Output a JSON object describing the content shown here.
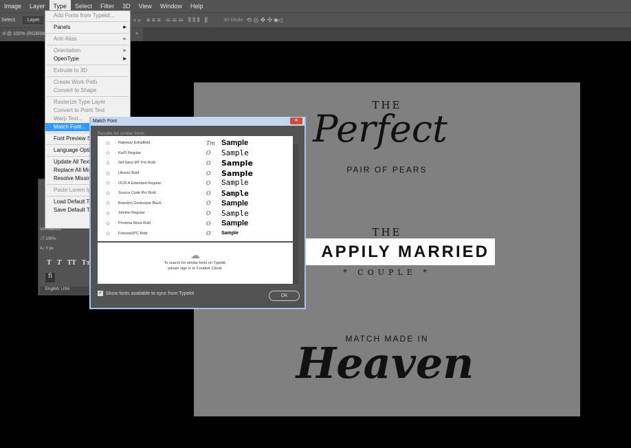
{
  "menubar": [
    "Image",
    "Layer",
    "Type",
    "Select",
    "Filter",
    "3D",
    "View",
    "Window",
    "Help"
  ],
  "options": {
    "select_label": "Select:",
    "select_value": "Layer",
    "mode_label": "3D Mode:"
  },
  "tab": {
    "title": "d @ 100% (RGB/8#)",
    "close": "×"
  },
  "type_menu": [
    {
      "label": "Add Fonts from Typekit...",
      "disabled": true
    },
    {
      "sep": true
    },
    {
      "label": "Panels",
      "sub": true
    },
    {
      "sep": true
    },
    {
      "label": "Anti-Alias",
      "disabled": true,
      "sub": true
    },
    {
      "sep": true
    },
    {
      "label": "Orientation",
      "disabled": true,
      "sub": true
    },
    {
      "label": "OpenType",
      "sub": true
    },
    {
      "sep": true
    },
    {
      "label": "Extrude to 3D",
      "disabled": true
    },
    {
      "sep": true
    },
    {
      "label": "Create Work Path",
      "disabled": true
    },
    {
      "label": "Convert to Shape",
      "disabled": true
    },
    {
      "sep": true
    },
    {
      "label": "Rasterize Type Layer",
      "disabled": true
    },
    {
      "label": "Convert to Point Text",
      "disabled": true
    },
    {
      "label": "Warp Text...",
      "disabled": true
    },
    {
      "label": "Match Font...",
      "highlight": true
    },
    {
      "sep": true
    },
    {
      "label": "Font Preview Size",
      "sub": true
    },
    {
      "sep": true
    },
    {
      "label": "Language Options",
      "sub": true
    },
    {
      "sep": true
    },
    {
      "label": "Update All Text Layers"
    },
    {
      "label": "Replace All Missing Fonts"
    },
    {
      "label": "Resolve Missing Fonts"
    },
    {
      "sep": true
    },
    {
      "label": "Paste Lorem Ipsum",
      "disabled": true
    },
    {
      "sep": true
    },
    {
      "label": "Load Default Type Styles"
    },
    {
      "label": "Save Default Type Styles"
    }
  ],
  "char_panel": {
    "kerning": "Metrics",
    "scale": "100%",
    "baseline": "0 px",
    "language": "English: USA",
    "styles": [
      "T",
      "T",
      "TT",
      "Tт"
    ]
  },
  "dialog": {
    "title": "Match Font",
    "close": "✕",
    "subtitle": "Results for similar fonts:",
    "fonts": [
      {
        "name": "Raleway ExtraBold",
        "icon": "Tт",
        "sample": "Sample"
      },
      {
        "name": "KaiTi Regular",
        "icon": "O",
        "sample": "Sample"
      },
      {
        "name": "Gill Sans MT Pro Bold",
        "icon": "O",
        "sample": "Sample"
      },
      {
        "name": "Ubuntu Bold",
        "icon": "O",
        "sample": "Sample"
      },
      {
        "name": "OCR A Extended Regular",
        "icon": "O",
        "sample": "Sample"
      },
      {
        "name": "Source Code Pro Bold",
        "icon": "O",
        "sample": "Sample"
      },
      {
        "name": "Brandon Grotesque Black",
        "icon": "O",
        "sample": "Sample"
      },
      {
        "name": "SimHei Regular",
        "icon": "O",
        "sample": "Sample"
      },
      {
        "name": "Proxima Nova Bold",
        "icon": "O",
        "sample": "Sample"
      },
      {
        "name": "FreesiaUPC Bold",
        "icon": "O",
        "sample": "Sample"
      }
    ],
    "typekit_line1": "To search for similar fonts on Typekit,",
    "typekit_line2": "please sign in to Creative Cloud.",
    "checkbox_label": "Show fonts available to sync from Typekit",
    "checkbox_checked": true,
    "ok": "OK"
  },
  "canvas": {
    "the1": "THE",
    "perfect": "Perfect",
    "pair": "PAIR OF PEARS",
    "the2": "THE",
    "married": "APPILY MARRIED",
    "couple": "* COUPLE *",
    "match": "MATCH MADE IN",
    "heaven": "Heaven"
  }
}
